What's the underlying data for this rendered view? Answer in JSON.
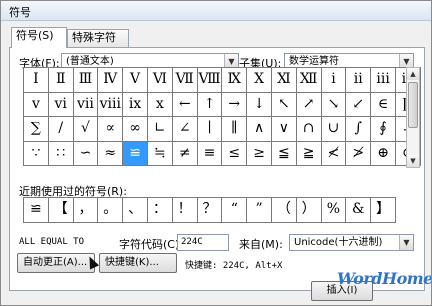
{
  "window": {
    "title": "符号"
  },
  "tabs": [
    {
      "label": "符号(S)"
    },
    {
      "label": "特殊字符(P)"
    }
  ],
  "font": {
    "label": "字体(F):",
    "value": "(普通文本)"
  },
  "subset": {
    "label": "子集(U):",
    "value": "数学运算符"
  },
  "grid": {
    "rows": [
      [
        "Ⅰ",
        "Ⅱ",
        "Ⅲ",
        "Ⅳ",
        "Ⅴ",
        "Ⅵ",
        "Ⅶ",
        "Ⅷ",
        "Ⅸ",
        "Ⅹ",
        "Ⅺ",
        "Ⅻ",
        "ⅰ",
        "ⅱ",
        "ⅲ",
        "ⅳ"
      ],
      [
        "ⅴ",
        "ⅵ",
        "ⅶ",
        "ⅷ",
        "ⅸ",
        "ⅹ",
        "←",
        "↑",
        "→",
        "↓",
        "↖",
        "↗",
        "↘",
        "↙",
        "∈",
        "∏"
      ],
      [
        "∑",
        "/",
        "√",
        "∝",
        "∞",
        "∟",
        "∠",
        "∣",
        "∥",
        "∧",
        "∨",
        "∩",
        "∪",
        "∫",
        "∮",
        "∴"
      ],
      [
        "∵",
        "∷",
        "∽",
        "≈",
        "≌",
        "≒",
        "≠",
        "≡",
        "≤",
        "≥",
        "≦",
        "≧",
        "≮",
        "≯",
        "⊕",
        "⊙"
      ]
    ],
    "selected": "≌"
  },
  "recent": {
    "label": "近期使用过的符号(R):",
    "items": [
      "≌",
      "【",
      "，",
      "。",
      "、",
      "：",
      "！",
      "？",
      "“",
      "”",
      "（",
      "）",
      "%",
      "&",
      "】"
    ]
  },
  "char_name": "ALL EQUAL TO",
  "char_code": {
    "label": "字符代码(C):",
    "value": "224C"
  },
  "from": {
    "label": "来自(M):",
    "value": "Unicode(十六进制)"
  },
  "buttons": {
    "autocorrect": "自动更正(A)...",
    "shortcut_key": "快捷键(K)...",
    "insert": "插入(I)"
  },
  "shortcut_text": "快捷键: 224C, Alt+X",
  "watermark": "WordHome"
}
